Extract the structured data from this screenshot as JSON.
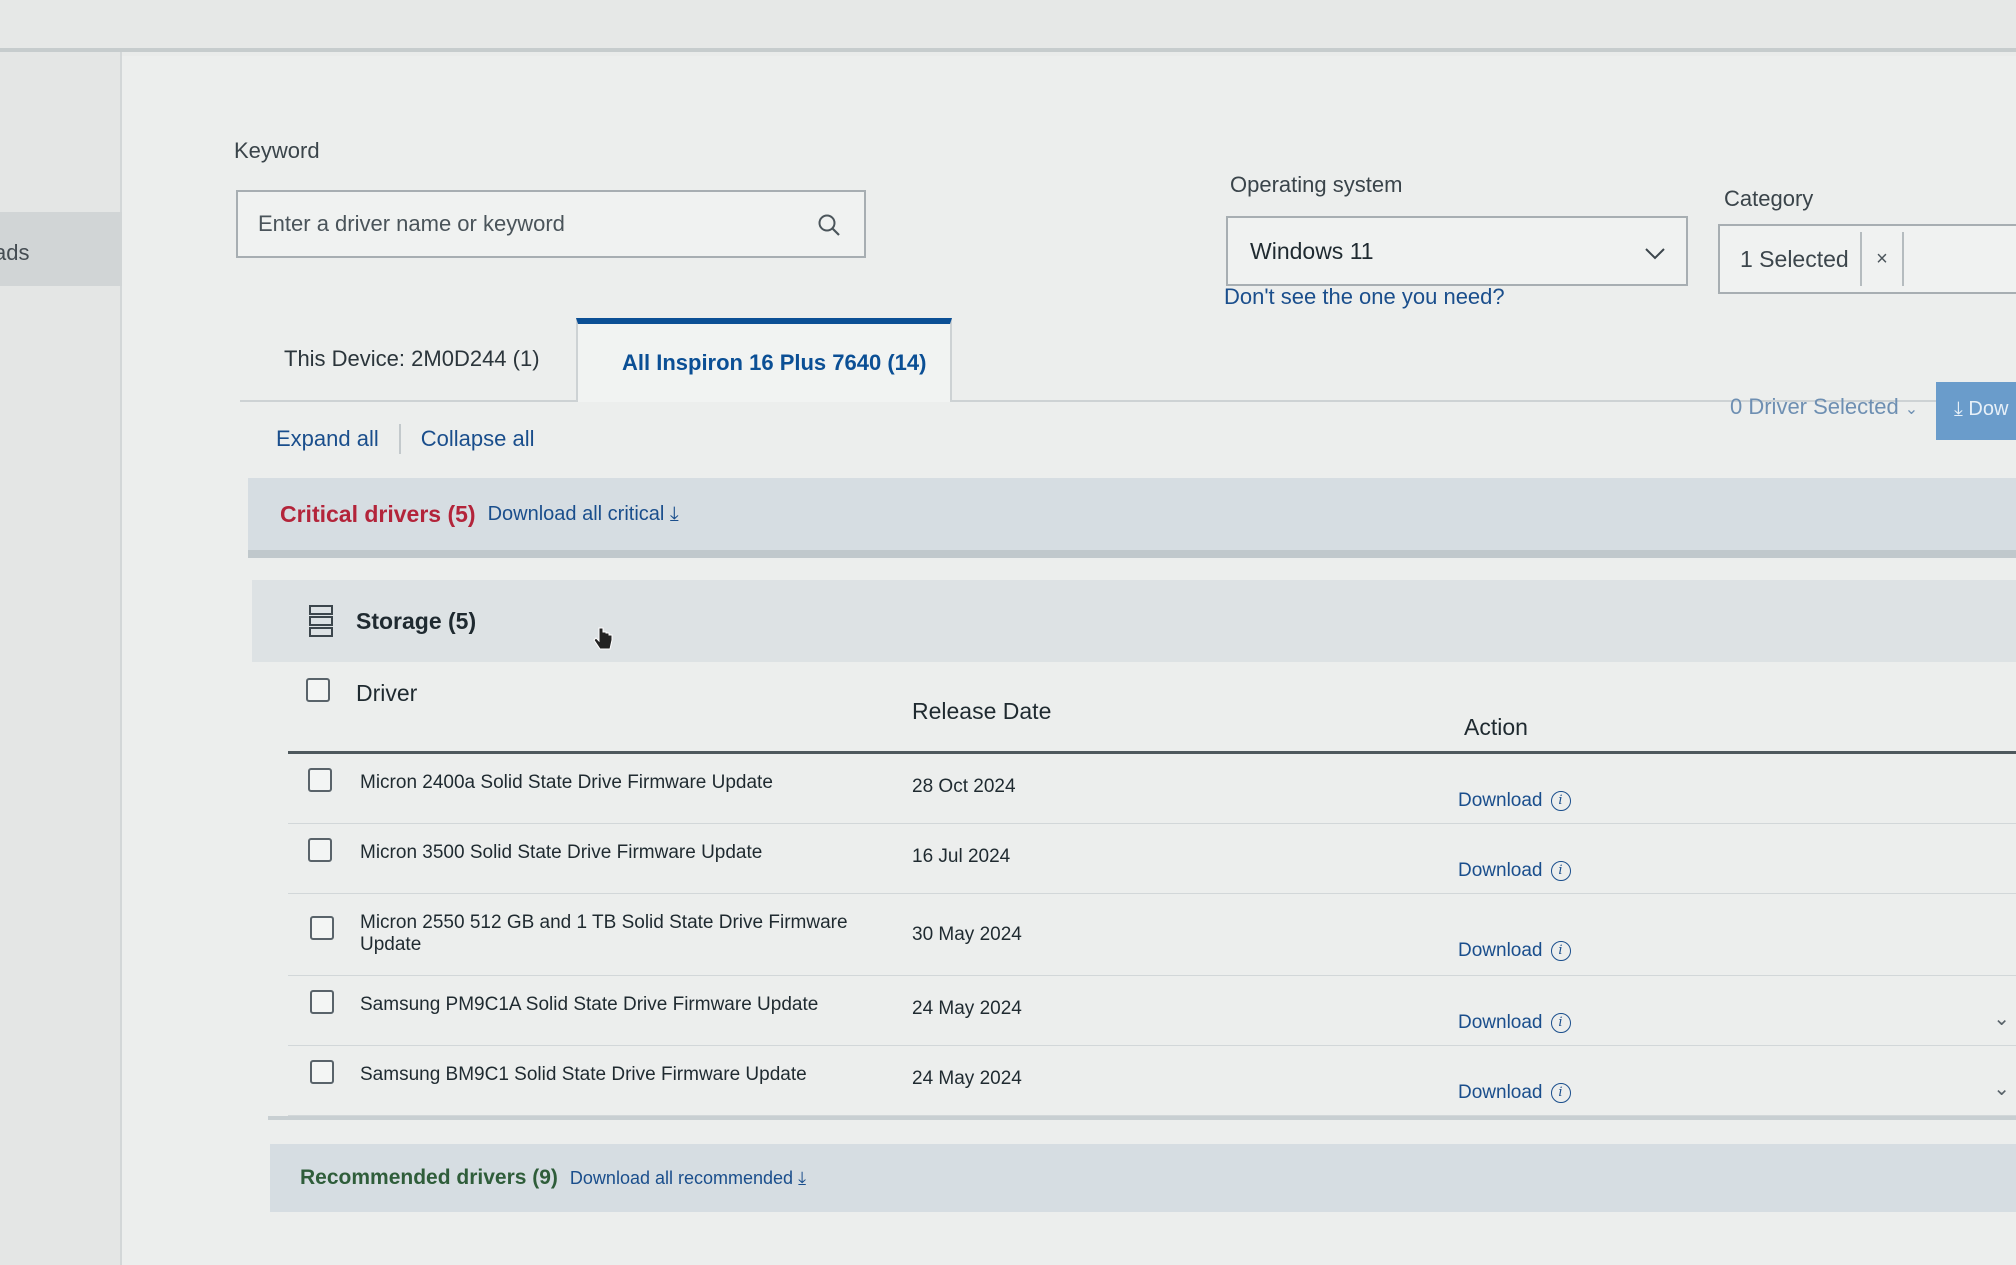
{
  "sidebar": {
    "active_item_label": "ads"
  },
  "filters": {
    "keyword_label": "Keyword",
    "keyword_placeholder": "Enter a driver name or keyword",
    "os_label": "Operating system",
    "os_value": "Windows 11",
    "os_help_link": "Don't see the one you need?",
    "category_label": "Category",
    "category_value": "1 Selected",
    "category_clear": "×"
  },
  "tabs": [
    {
      "label": "This Device: 2M0D244 (1)",
      "active": false
    },
    {
      "label": "All Inspiron 16 Plus 7640 (14)",
      "active": true
    }
  ],
  "toolbar": {
    "drivers_selected": "0 Driver Selected",
    "download_button": "Dow"
  },
  "expand": {
    "expand_all": "Expand all",
    "collapse_all": "Collapse all"
  },
  "critical": {
    "title": "Critical drivers (5)",
    "download_all": "Download all critical"
  },
  "group": {
    "label": "Storage (5)"
  },
  "table": {
    "headers": {
      "driver": "Driver",
      "release_date": "Release Date",
      "action": "Action"
    },
    "rows": [
      {
        "name": "Micron 2400a Solid State Drive Firmware Update",
        "date": "28 Oct 2024",
        "action": "Download"
      },
      {
        "name": "Micron 3500 Solid State Drive Firmware Update",
        "date": "16 Jul 2024",
        "action": "Download"
      },
      {
        "name": "Micron 2550 512 GB and 1 TB Solid State Drive Firmware Update",
        "date": "30 May 2024",
        "action": "Download"
      },
      {
        "name": "Samsung PM9C1A Solid State Drive Firmware Update",
        "date": "24 May 2024",
        "action": "Download"
      },
      {
        "name": "Samsung BM9C1 Solid State Drive Firmware Update",
        "date": "24 May 2024",
        "action": "Download"
      }
    ]
  },
  "recommended": {
    "title": "Recommended drivers (9)",
    "download_all": "Download all recommended"
  },
  "colors": {
    "link_blue": "#1a4e8c",
    "critical_red": "#b3243a",
    "recommended_green": "#2f5d3a",
    "button_blue": "#6a9ccb"
  }
}
